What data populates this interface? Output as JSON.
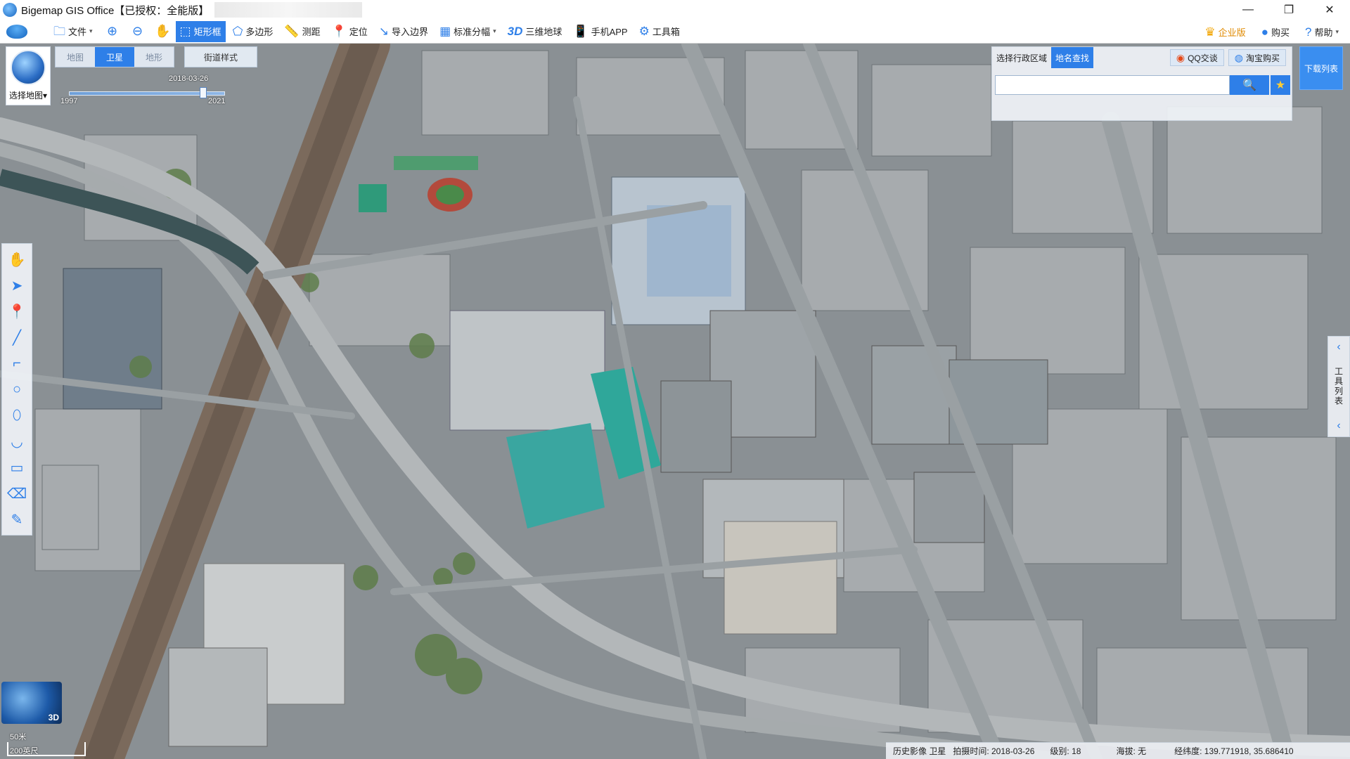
{
  "window": {
    "title": "Bigemap GIS Office【已授权：全能版】",
    "controls": {
      "minimize": "—",
      "restore": "❐",
      "close": "✕"
    }
  },
  "toolbar": {
    "items": [
      {
        "label": "文件",
        "icon": "folder-icon",
        "caret": "▾"
      },
      {
        "label": "",
        "icon": "zoom-in-icon"
      },
      {
        "label": "",
        "icon": "zoom-out-icon"
      },
      {
        "label": "",
        "icon": "hand-icon"
      },
      {
        "label": "矩形框",
        "icon": "rectangle-select-icon",
        "active": true
      },
      {
        "label": "多边形",
        "icon": "polygon-icon"
      },
      {
        "label": "测距",
        "icon": "ruler-icon"
      },
      {
        "label": "定位",
        "icon": "location-pin-icon"
      },
      {
        "label": "导入边界",
        "icon": "import-icon"
      },
      {
        "label": "标准分幅",
        "icon": "grid-icon",
        "caret": "▾"
      },
      {
        "label": "三维地球",
        "icon": "3d-icon",
        "prefix": "3D"
      },
      {
        "label": "手机APP",
        "icon": "phone-icon"
      },
      {
        "label": "工具箱",
        "icon": "gear-icon"
      }
    ],
    "right": [
      {
        "label": "企业版",
        "icon": "crown-icon"
      },
      {
        "label": "购买",
        "icon": "buy-icon"
      },
      {
        "label": "帮助",
        "icon": "help-icon",
        "caret": "▾"
      }
    ]
  },
  "map_type": {
    "select_label": "选择地图",
    "tabs": [
      "地图",
      "卫星",
      "地形"
    ],
    "active_tab": "卫星",
    "street_style": "街道样式",
    "timeline": {
      "current_date": "2018-03-26",
      "start_year": "1997",
      "end_year": "2021",
      "position": 0.86
    }
  },
  "search": {
    "tabs": [
      "选择行政区域",
      "地名查找"
    ],
    "active_tab": "地名查找",
    "qq": "QQ交谈",
    "taobao": "淘宝购买",
    "placeholder": "",
    "search_icon": "search-icon",
    "star_icon": "star-icon"
  },
  "download_list": "下载列表",
  "tools": [
    "hand-icon",
    "pointer-icon",
    "marker-icon",
    "line-icon",
    "polyline-icon",
    "circle-icon",
    "freehand-icon",
    "arc-icon",
    "rectangle-icon",
    "eraser-icon",
    "edit-icon"
  ],
  "right_panel": {
    "label": "工具列表"
  },
  "minimap": {
    "label": "3D"
  },
  "scale": {
    "metric": "50米",
    "imperial": "200英尺"
  },
  "status": {
    "source": "历史影像 卫星",
    "shot_time_label": "拍摄时间: 2018-03-26",
    "level_label": "级别: 18",
    "altitude_label": "海拔: 无",
    "coords_label": "经纬度: 139.771918, 35.686410"
  },
  "colors": {
    "accent": "#2e7fe8",
    "map_base": "#7d8488",
    "greenery": "#5e7d4a",
    "road": "#9aa0a3"
  }
}
